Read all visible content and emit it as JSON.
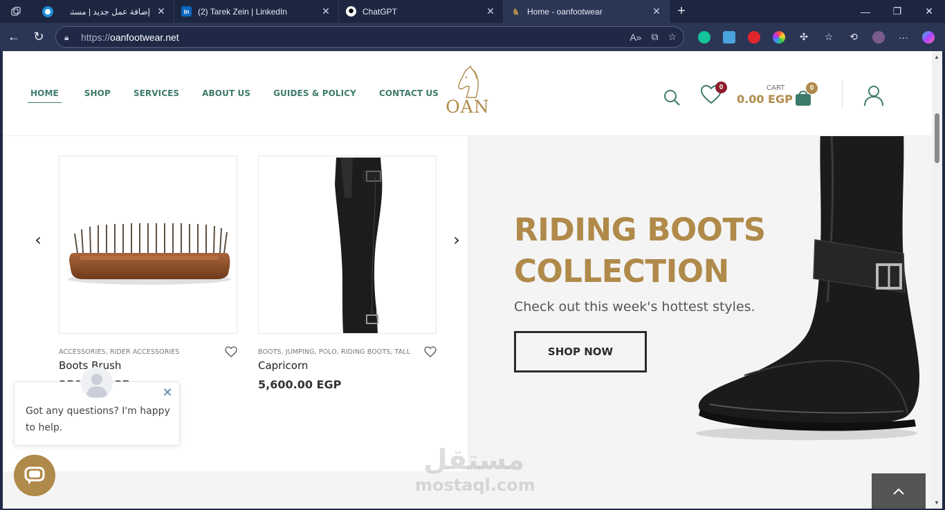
{
  "browser": {
    "tabs": [
      {
        "title": "إضافة عمل جديد | مستقل",
        "favicon": "mostaql-icon"
      },
      {
        "title": "(2) Tarek Zein | LinkedIn",
        "favicon": "linkedin-icon"
      },
      {
        "title": "ChatGPT",
        "favicon": "chatgpt-icon"
      },
      {
        "title": "Home - oanfootwear",
        "favicon": "oan-horse-icon",
        "active": true
      }
    ],
    "url_scheme": "https://",
    "url_host": "oanfootwear.net"
  },
  "site": {
    "menu": [
      {
        "label": "HOME",
        "active": true
      },
      {
        "label": "SHOP"
      },
      {
        "label": "SERVICES"
      },
      {
        "label": "ABOUT US"
      },
      {
        "label": "GUIDES & POLICY"
      },
      {
        "label": "CONTACT US"
      }
    ],
    "logo_text": "OAN",
    "wishlist_count": "0",
    "cart_label": "CART",
    "cart_amount": "0.00 EGP",
    "cart_count": "0"
  },
  "products": [
    {
      "categories": "ACCESSORIES, RIDER ACCESSORIES",
      "name": "Boots Brush",
      "price": "250.00 EGP"
    },
    {
      "categories": "BOOTS, JUMPING, POLO, RIDING BOOTS, TALL",
      "name": "Capricorn",
      "price": "5,600.00 EGP"
    }
  ],
  "hero": {
    "title_line1": "RIDING BOOTS",
    "title_line2": "COLLECTION",
    "subtitle": "Check out this week's hottest styles.",
    "button": "SHOP NOW"
  },
  "chat": {
    "message": "Got any questions? I'm happy to help."
  },
  "watermark": {
    "arabic": "مستقل",
    "latin": "mostaql.com"
  },
  "colors": {
    "brand_green": "#3e7a6b",
    "brand_gold": "#b08a4a",
    "badge_red": "#8c1d2b"
  }
}
